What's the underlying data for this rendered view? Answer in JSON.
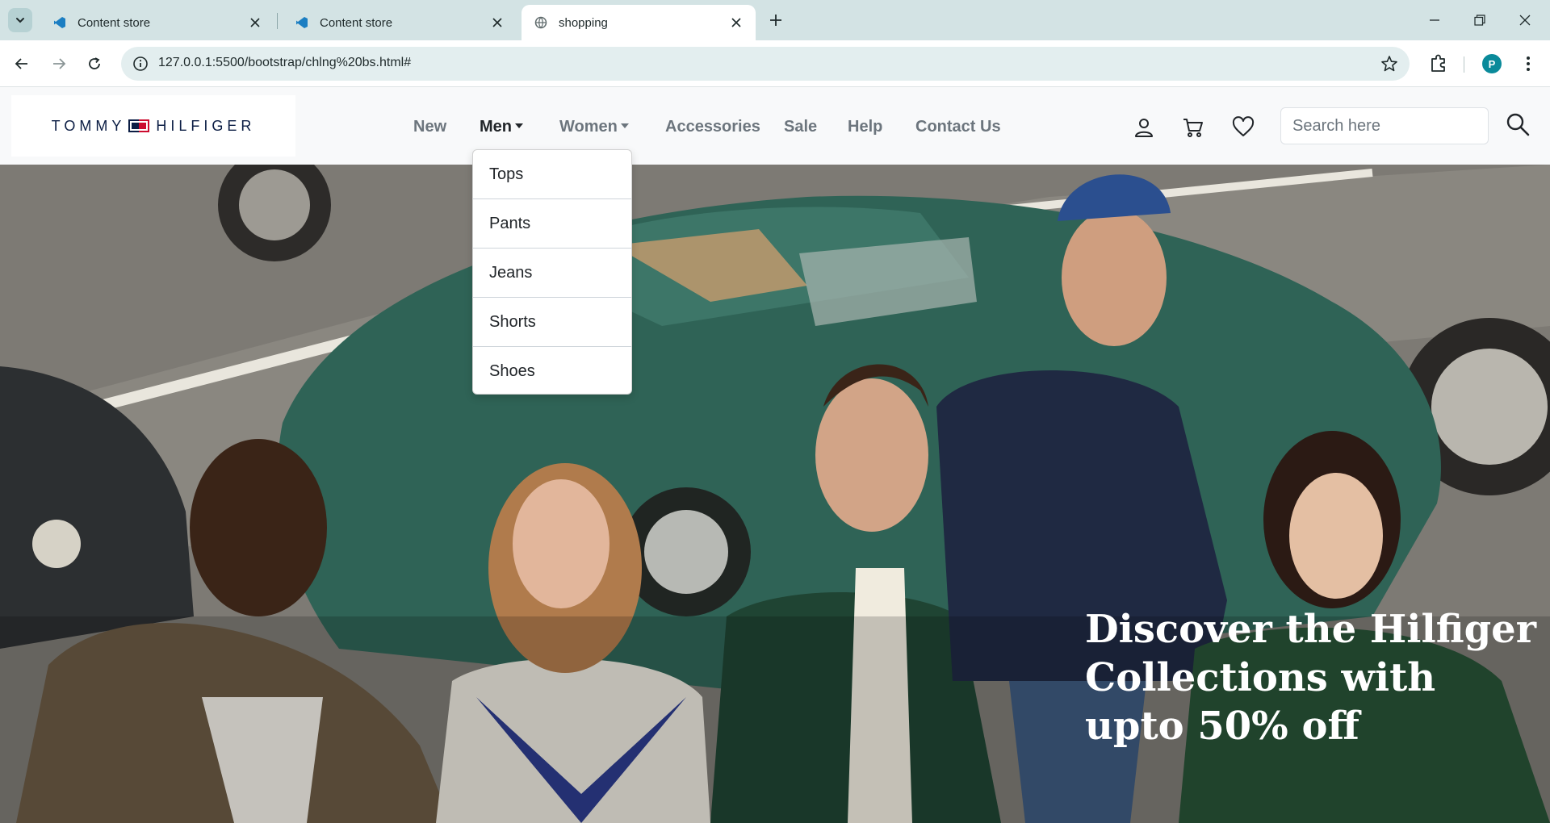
{
  "browser": {
    "tabs": [
      {
        "title": "Content store",
        "icon": "vscode-icon",
        "active": false
      },
      {
        "title": "Content store",
        "icon": "vscode-icon",
        "active": false
      },
      {
        "title": "shopping",
        "icon": "globe-icon",
        "active": true
      }
    ],
    "url": "127.0.0.1:5500/bootstrap/chlng%20bs.html#",
    "profile_initial": "P"
  },
  "site": {
    "logo": {
      "left": "TOMMY",
      "right": "HILFIGER",
      "colors": {
        "navy": "#0b1d44",
        "red": "#cc0c2f"
      }
    },
    "nav": [
      {
        "label": "New",
        "dropdown": false,
        "active": false
      },
      {
        "label": "Men",
        "dropdown": true,
        "active": true
      },
      {
        "label": "Women",
        "dropdown": true,
        "active": false
      },
      {
        "label": "Accessories",
        "dropdown": false,
        "active": false
      },
      {
        "label": "Sale",
        "dropdown": false,
        "active": false
      },
      {
        "label": "Help",
        "dropdown": false,
        "active": false
      },
      {
        "label": "Contact Us",
        "dropdown": false,
        "active": false
      }
    ],
    "icons": [
      "user-icon",
      "cart-icon",
      "heart-icon"
    ],
    "search": {
      "placeholder": "Search here",
      "value": ""
    },
    "men_dropdown": [
      "Tops",
      "Pants",
      "Jeans",
      "Shorts",
      "Shoes"
    ]
  },
  "hero": {
    "heading_lines": [
      "Discover the Hilfiger",
      "Collections with",
      "upto 50% off"
    ],
    "heading_color": "#ffffff"
  }
}
